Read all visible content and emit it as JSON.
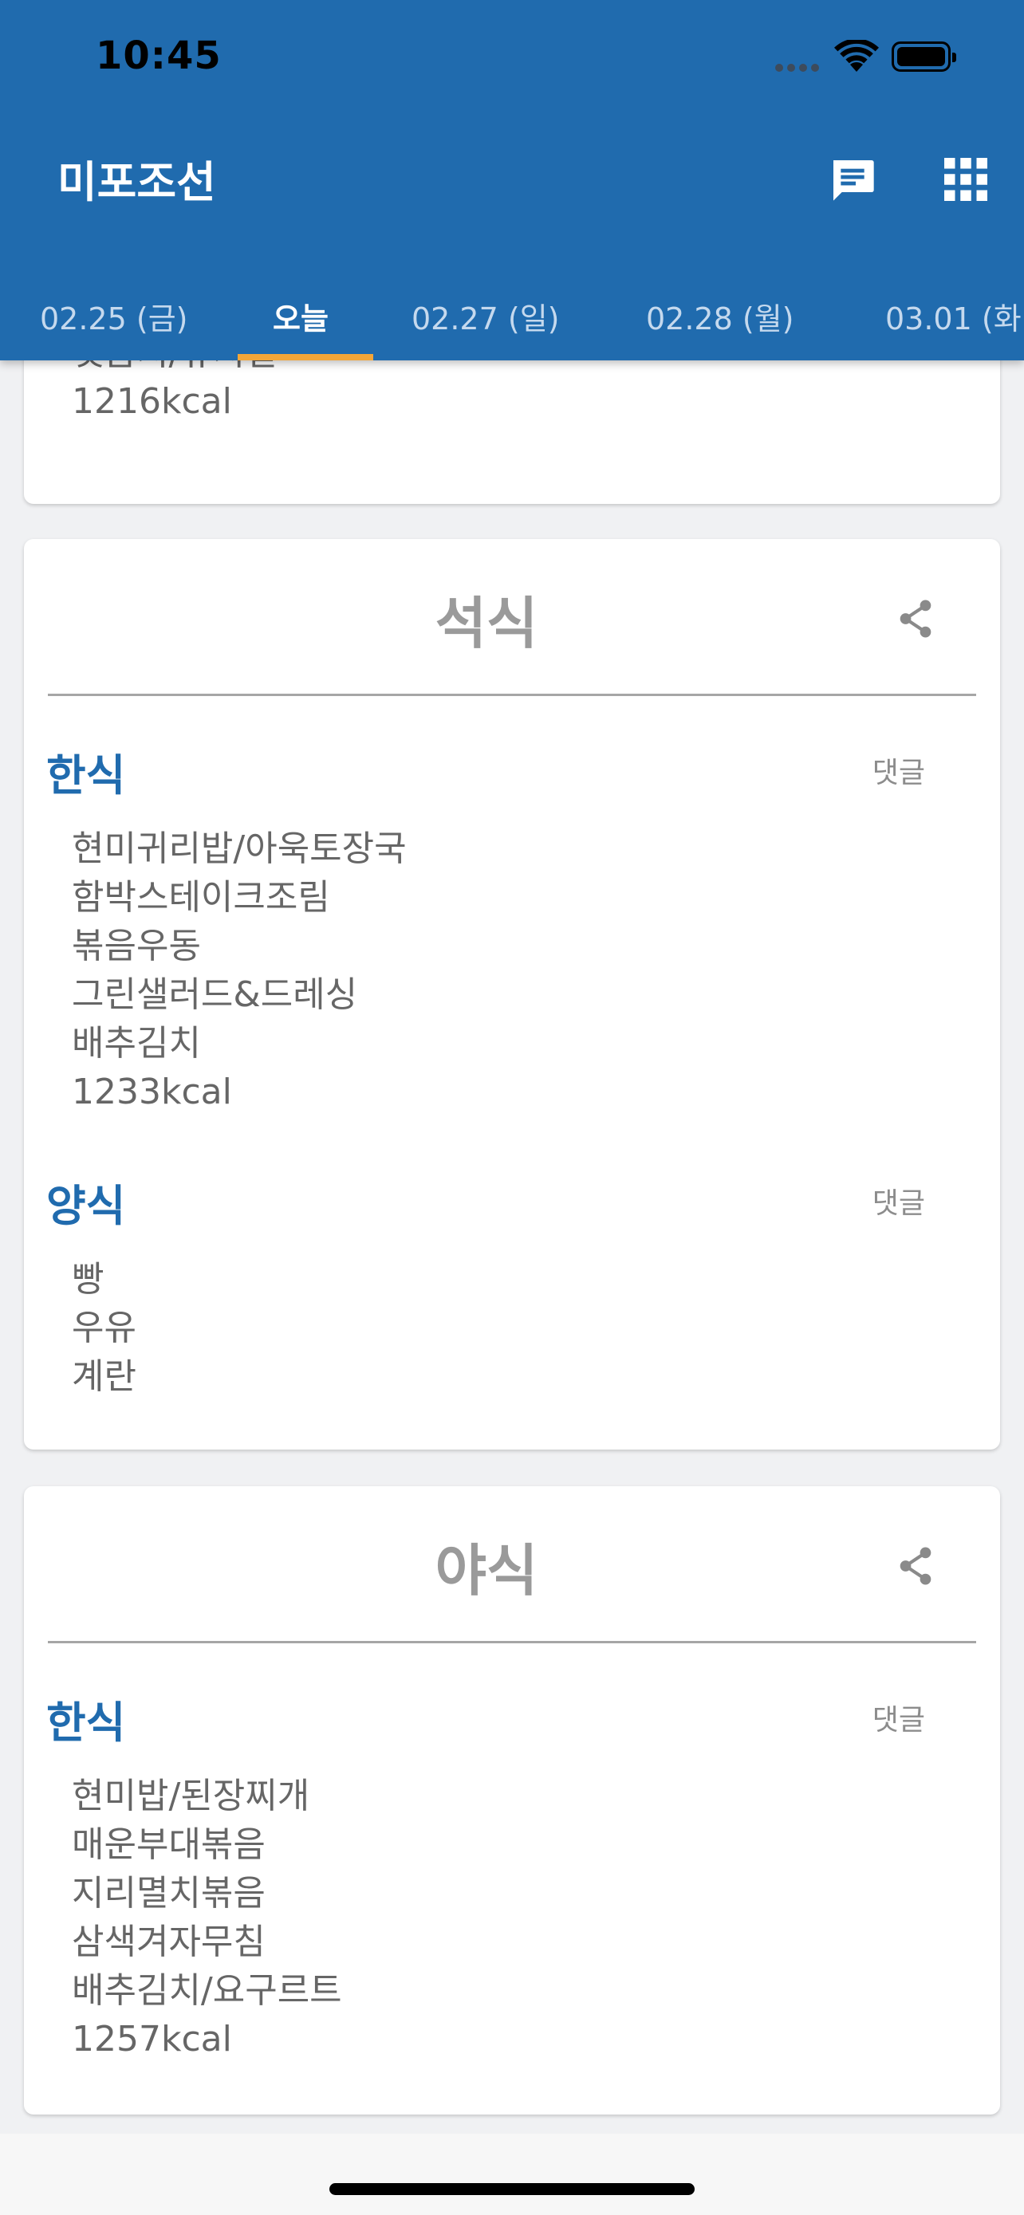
{
  "status_bar": {
    "time": "10:45"
  },
  "app": {
    "title": "미포조선"
  },
  "tabs": [
    {
      "label": "02.25 (금)"
    },
    {
      "label": "오늘"
    },
    {
      "label": "02.27 (일)"
    },
    {
      "label": "02.28 (월)"
    },
    {
      "label": "03.01 (화"
    }
  ],
  "active_tab": "오늘",
  "colors": {
    "primary": "#206bae",
    "accent": "#f3a638",
    "category": "#206bae"
  },
  "icons": {
    "header_left": "message-icon",
    "header_right": "apps-grid-icon",
    "card_action": "share-icon"
  },
  "cut_off_card": {
    "lines": [
      "샛음치/유치일",
      "1216kcal"
    ]
  },
  "meals": [
    {
      "title": "석식",
      "sections": [
        {
          "category": "한식",
          "comment_label": "댓글",
          "items": [
            "현미귀리밥/아욱토장국",
            "함박스테이크조림",
            "볶음우동",
            "그린샐러드&드레싱",
            "배추김치",
            "1233kcal"
          ]
        },
        {
          "category": "양식",
          "comment_label": "댓글",
          "items": [
            "빵",
            "우유",
            "계란"
          ]
        }
      ]
    },
    {
      "title": "야식",
      "sections": [
        {
          "category": "한식",
          "comment_label": "댓글",
          "items": [
            "현미밥/된장찌개",
            "매운부대볶음",
            "지리멸치볶음",
            "삼색겨자무침",
            "배추김치/요구르트",
            "1257kcal"
          ]
        }
      ]
    }
  ]
}
